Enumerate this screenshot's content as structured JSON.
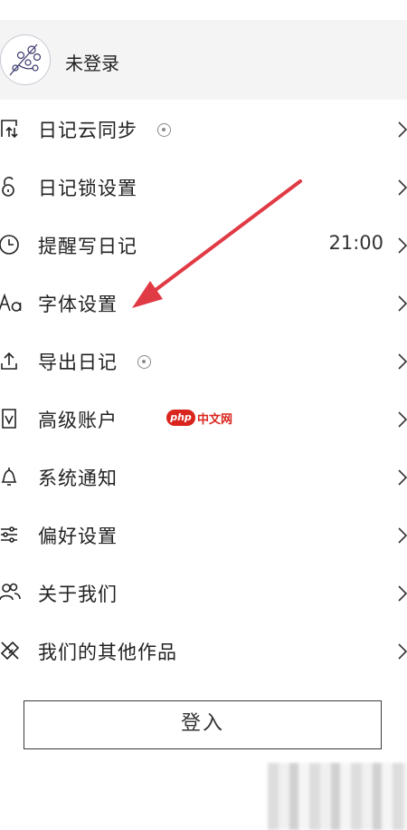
{
  "profile": {
    "name": "未登录",
    "avatar_icon": "floral-avatar-icon"
  },
  "menu": [
    {
      "id": "cloud-sync",
      "label": "日记云同步",
      "icon": "cloud-sync-icon",
      "badge": true,
      "value": ""
    },
    {
      "id": "diary-lock",
      "label": "日记锁设置",
      "icon": "lock-icon",
      "badge": false,
      "value": ""
    },
    {
      "id": "reminder",
      "label": "提醒写日记",
      "icon": "clock-icon",
      "badge": false,
      "value": "21:00"
    },
    {
      "id": "font-settings",
      "label": "字体设置",
      "icon": "font-icon",
      "badge": false,
      "value": ""
    },
    {
      "id": "export",
      "label": "导出日记",
      "icon": "export-icon",
      "badge": true,
      "value": ""
    },
    {
      "id": "premium",
      "label": "高级账户",
      "icon": "premium-icon",
      "badge": false,
      "value": ""
    },
    {
      "id": "notifications",
      "label": "系统通知",
      "icon": "bell-icon",
      "badge": false,
      "value": ""
    },
    {
      "id": "preferences",
      "label": "偏好设置",
      "icon": "sliders-icon",
      "badge": false,
      "value": ""
    },
    {
      "id": "about",
      "label": "关于我们",
      "icon": "people-icon",
      "badge": false,
      "value": ""
    },
    {
      "id": "other-works",
      "label": "我们的其他作品",
      "icon": "tools-icon",
      "badge": false,
      "value": ""
    }
  ],
  "login_button": {
    "label": "登入"
  },
  "watermark": {
    "logo": "php",
    "text": "中文网"
  },
  "colors": {
    "arrow": "#e03a45",
    "watermark": "#d9251d"
  }
}
